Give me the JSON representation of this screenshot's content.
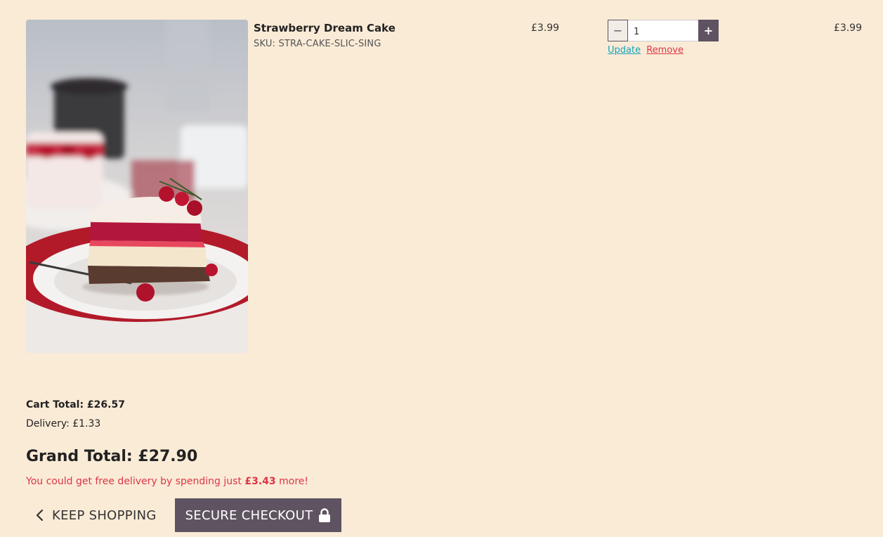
{
  "cart_item": {
    "image_icon": "cake-photo",
    "name": "Strawberry Dream Cake",
    "sku": "SKU: STRA-CAKE-SLIC-SING",
    "price": "£3.99",
    "quantity": "1",
    "quantity_minus_icon": "minus-icon",
    "quantity_plus_icon": "plus-icon",
    "update_label": "Update",
    "remove_label": "Remove",
    "subtotal": "£3.99"
  },
  "totals": {
    "cart_total": "Cart Total: £26.57",
    "delivery": "Delivery: £1.33",
    "grand_total": "Grand Total: £27.90",
    "free_delivery_prefix": "You could get free delivery by spending just ",
    "free_delivery_amount": "£3.43",
    "free_delivery_suffix": " more!"
  },
  "actions": {
    "keep_shopping_label": "KEEP SHOPPING",
    "keep_shopping_icon": "chevron-left-icon",
    "checkout_label": "SECURE CHECKOUT",
    "checkout_icon": "lock-icon"
  },
  "colors": {
    "background": "#faebd7",
    "accent": "#5f5361",
    "info": "#17a2b8",
    "danger": "#dc3545"
  }
}
